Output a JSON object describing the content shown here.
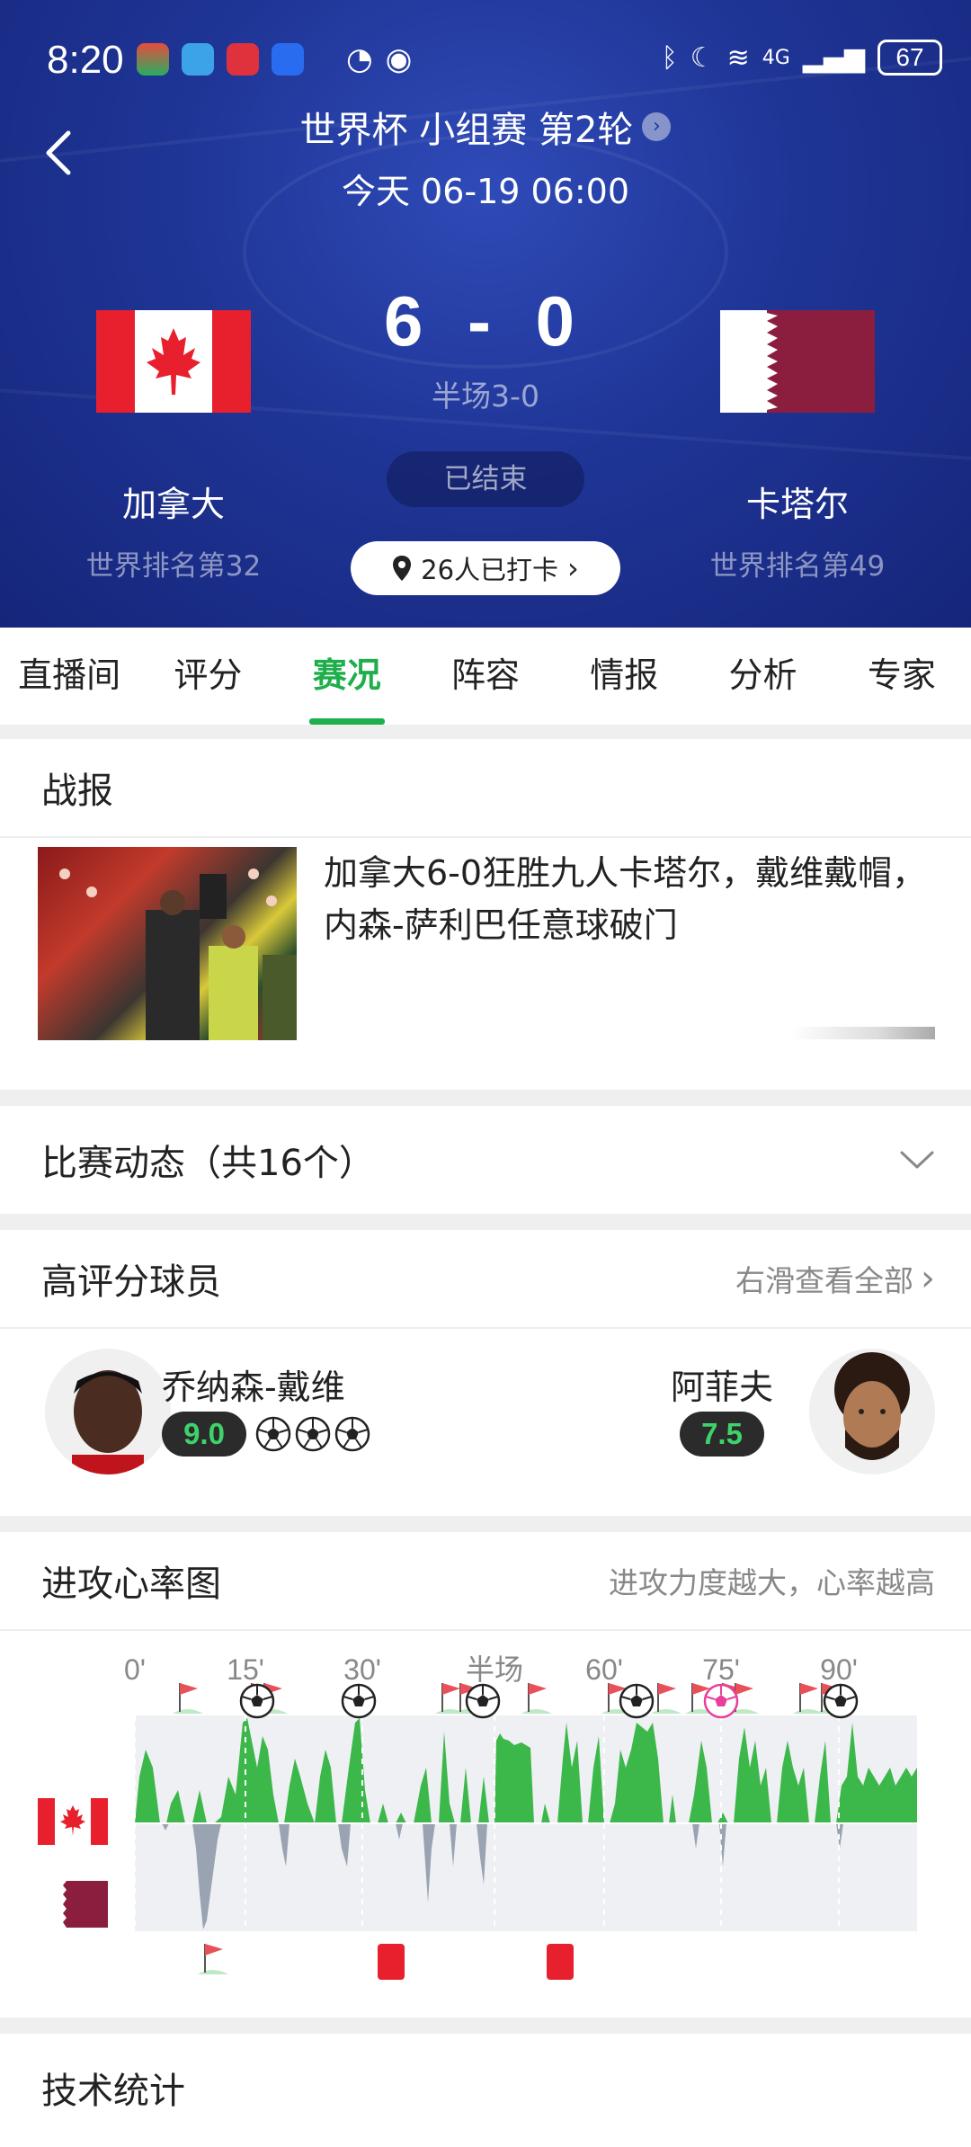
{
  "status_bar": {
    "time": "8:20",
    "network": "4G",
    "battery": "67"
  },
  "header": {
    "title": "世界杯 小组赛 第2轮",
    "datetime": "今天 06-19 06:00"
  },
  "match": {
    "home": {
      "name": "加拿大",
      "rank": "世界排名第32"
    },
    "away": {
      "name": "卡塔尔",
      "rank": "世界排名第49"
    },
    "score": "6 - 0",
    "halftime": "半场3-0",
    "status": "已结束",
    "checkin": "26人已打卡"
  },
  "tabs": [
    "直播间",
    "评分",
    "赛况",
    "阵容",
    "情报",
    "分析",
    "专家"
  ],
  "active_tab": "赛况",
  "report": {
    "title": "战报",
    "headline": "加拿大6-0狂胜九人卡塔尔，戴维戴帽，内森-萨利巴任意球破门"
  },
  "events": {
    "title": "比赛动态（共16个）"
  },
  "top_players": {
    "title": "高评分球员",
    "hint": "右滑查看全部",
    "home": {
      "name": "乔纳森-戴维",
      "rating": "9.0",
      "goals": 3
    },
    "away": {
      "name": "阿菲夫",
      "rating": "7.5"
    }
  },
  "momentum": {
    "title": "进攻心率图",
    "hint": "进攻力度越大，心率越高",
    "ticks": [
      "0'",
      "15'",
      "30'",
      "半场",
      "60'",
      "75'",
      "90'"
    ]
  },
  "stats": {
    "title": "技术统计"
  },
  "colors": {
    "accent": "#1fae4c",
    "header_bg": "#1f3596",
    "home_wave": "#3cb84a",
    "away_wave": "#9aa3b2",
    "red_card": "#e8202e"
  }
}
